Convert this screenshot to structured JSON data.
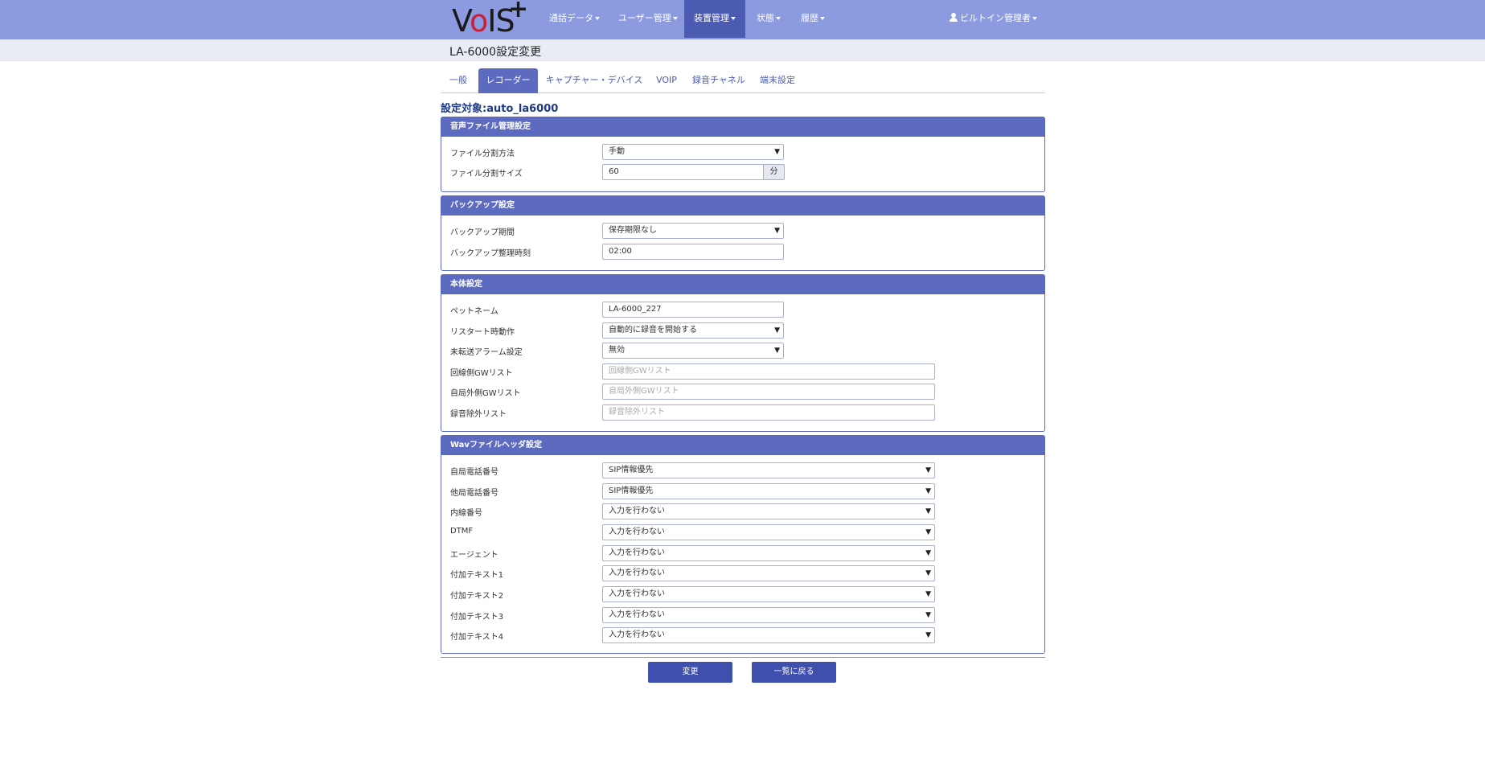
{
  "nav": {
    "logo_main": "V",
    "logo_o": "o",
    "logo_rest": "IS",
    "logo_plus": "+",
    "items": [
      "通話データ",
      "ユーザー管理",
      "装置管理",
      "状態",
      "履歴"
    ],
    "user": "ビルトイン管理者"
  },
  "page_title": "LA-6000設定変更",
  "tabs": [
    "一般",
    "レコーダー",
    "キャプチャー・デバイス",
    "VOIP",
    "録音チャネル",
    "端末設定"
  ],
  "target_label": "設定対象:auto_la6000",
  "audio_panel": {
    "title": "音声ファイル管理設定",
    "split_method_label": "ファイル分割方法",
    "split_method_value": "手動",
    "split_size_label": "ファイル分割サイズ",
    "split_size_value": "60",
    "split_size_unit": "分"
  },
  "backup_panel": {
    "title": "バックアップ設定",
    "period_label": "バックアップ期間",
    "period_value": "保存期限なし",
    "time_label": "バックアップ整理時刻",
    "time_value": "02:00"
  },
  "main_panel": {
    "title": "本体設定",
    "petname_label": "ペットネーム",
    "petname_value": "LA-6000_227",
    "restart_label": "リスタート時動作",
    "restart_value": "自動的に録音を開始する",
    "alarm_label": "未転送アラーム設定",
    "alarm_value": "無効",
    "line_gw_label": "回線側GWリスト",
    "line_gw_placeholder": "回線側GWリスト",
    "ext_gw_label": "自局外側GWリスト",
    "ext_gw_placeholder": "自局外側GWリスト",
    "exclude_label": "録音除外リスト",
    "exclude_placeholder": "録音除外リスト"
  },
  "wav_panel": {
    "title": "Wavファイルヘッダ設定",
    "rows": [
      {
        "label": "自局電話番号",
        "value": "SIP情報優先"
      },
      {
        "label": "他局電話番号",
        "value": "SIP情報優先"
      },
      {
        "label": "内線番号",
        "value": "入力を行わない"
      },
      {
        "label": "DTMF",
        "value": "入力を行わない"
      },
      {
        "label": "エージェント",
        "value": "入力を行わない"
      },
      {
        "label": "付加テキスト1",
        "value": "入力を行わない"
      },
      {
        "label": "付加テキスト2",
        "value": "入力を行わない"
      },
      {
        "label": "付加テキスト3",
        "value": "入力を行わない"
      },
      {
        "label": "付加テキスト4",
        "value": "入力を行わない"
      }
    ]
  },
  "buttons": {
    "change": "変更",
    "back": "一覧に戻る"
  }
}
